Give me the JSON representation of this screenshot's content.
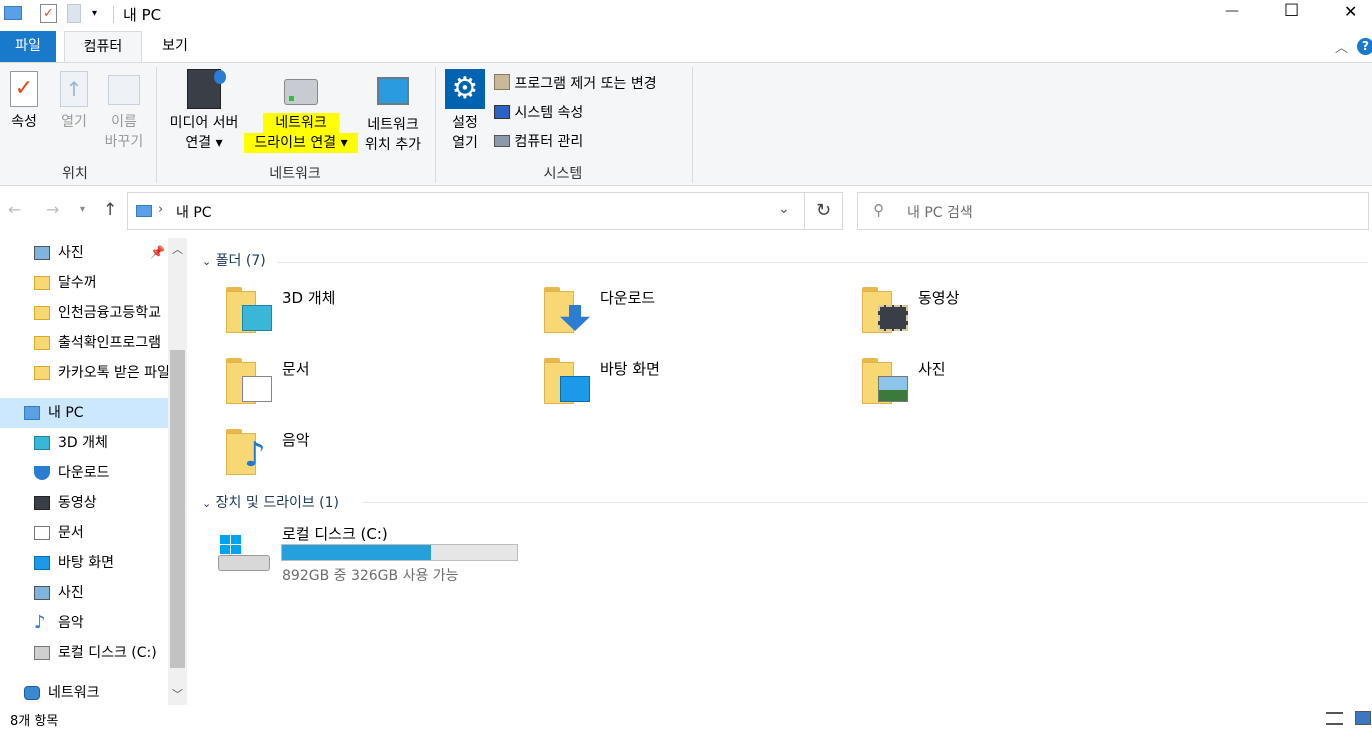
{
  "window": {
    "title": "내 PC",
    "minimize": "—",
    "maximize": "☐",
    "close": "✕"
  },
  "tabs": {
    "file": "파일",
    "computer": "컴퓨터",
    "view": "보기"
  },
  "ribbon": {
    "location": {
      "properties": "속성",
      "open": "열기",
      "rename_1": "이름",
      "rename_2": "바꾸기",
      "label": "위치"
    },
    "network": {
      "media_1": "미디어 서버",
      "media_2": "연결",
      "map_1": "네트워크",
      "map_2": "드라이브 연결",
      "add_1": "네트워크",
      "add_2": "위치 추가",
      "label": "네트워크"
    },
    "system": {
      "settings_1": "설정",
      "settings_2": "열기",
      "uninstall": "프로그램 제거 또는 변경",
      "sysprops": "시스템 속성",
      "manage": "컴퓨터 관리",
      "label": "시스템"
    }
  },
  "address": {
    "path": "내 PC",
    "search_placeholder": "내 PC 검색"
  },
  "nav": [
    {
      "label": "사진",
      "icon": "pictures-icon"
    },
    {
      "label": "달수꺼",
      "icon": "folder-icon"
    },
    {
      "label": "인천금융고등학교",
      "icon": "folder-icon"
    },
    {
      "label": "출석확인프로그램",
      "icon": "folder-icon"
    },
    {
      "label": "카카오톡 받은 파일",
      "icon": "folder-icon"
    },
    {
      "label": "내 PC",
      "icon": "pc-icon"
    },
    {
      "label": "3D 개체",
      "icon": "cube-icon"
    },
    {
      "label": "다운로드",
      "icon": "download-icon"
    },
    {
      "label": "동영상",
      "icon": "video-icon"
    },
    {
      "label": "문서",
      "icon": "document-icon"
    },
    {
      "label": "바탕 화면",
      "icon": "desktop-icon"
    },
    {
      "label": "사진",
      "icon": "pictures-icon"
    },
    {
      "label": "음악",
      "icon": "music-icon"
    },
    {
      "label": "로컬 디스크 (C:)",
      "icon": "drive-icon"
    },
    {
      "label": "네트워크",
      "icon": "network-icon"
    }
  ],
  "main": {
    "folders_header": "폴더 (7)",
    "folders": [
      "3D 개체",
      "다운로드",
      "동영상",
      "문서",
      "바탕 화면",
      "사진",
      "음악"
    ],
    "drives_header": "장치 및 드라이브 (1)",
    "drive": {
      "name": "로컬 디스크 (C:)",
      "space": "892GB 중 326GB 사용 가능",
      "used_fraction": 0.635
    }
  },
  "status": {
    "count": "8개 항목"
  },
  "colors": {
    "accent": "#0063b1",
    "highlight": "#ffff00",
    "bar": "#26a0da"
  }
}
